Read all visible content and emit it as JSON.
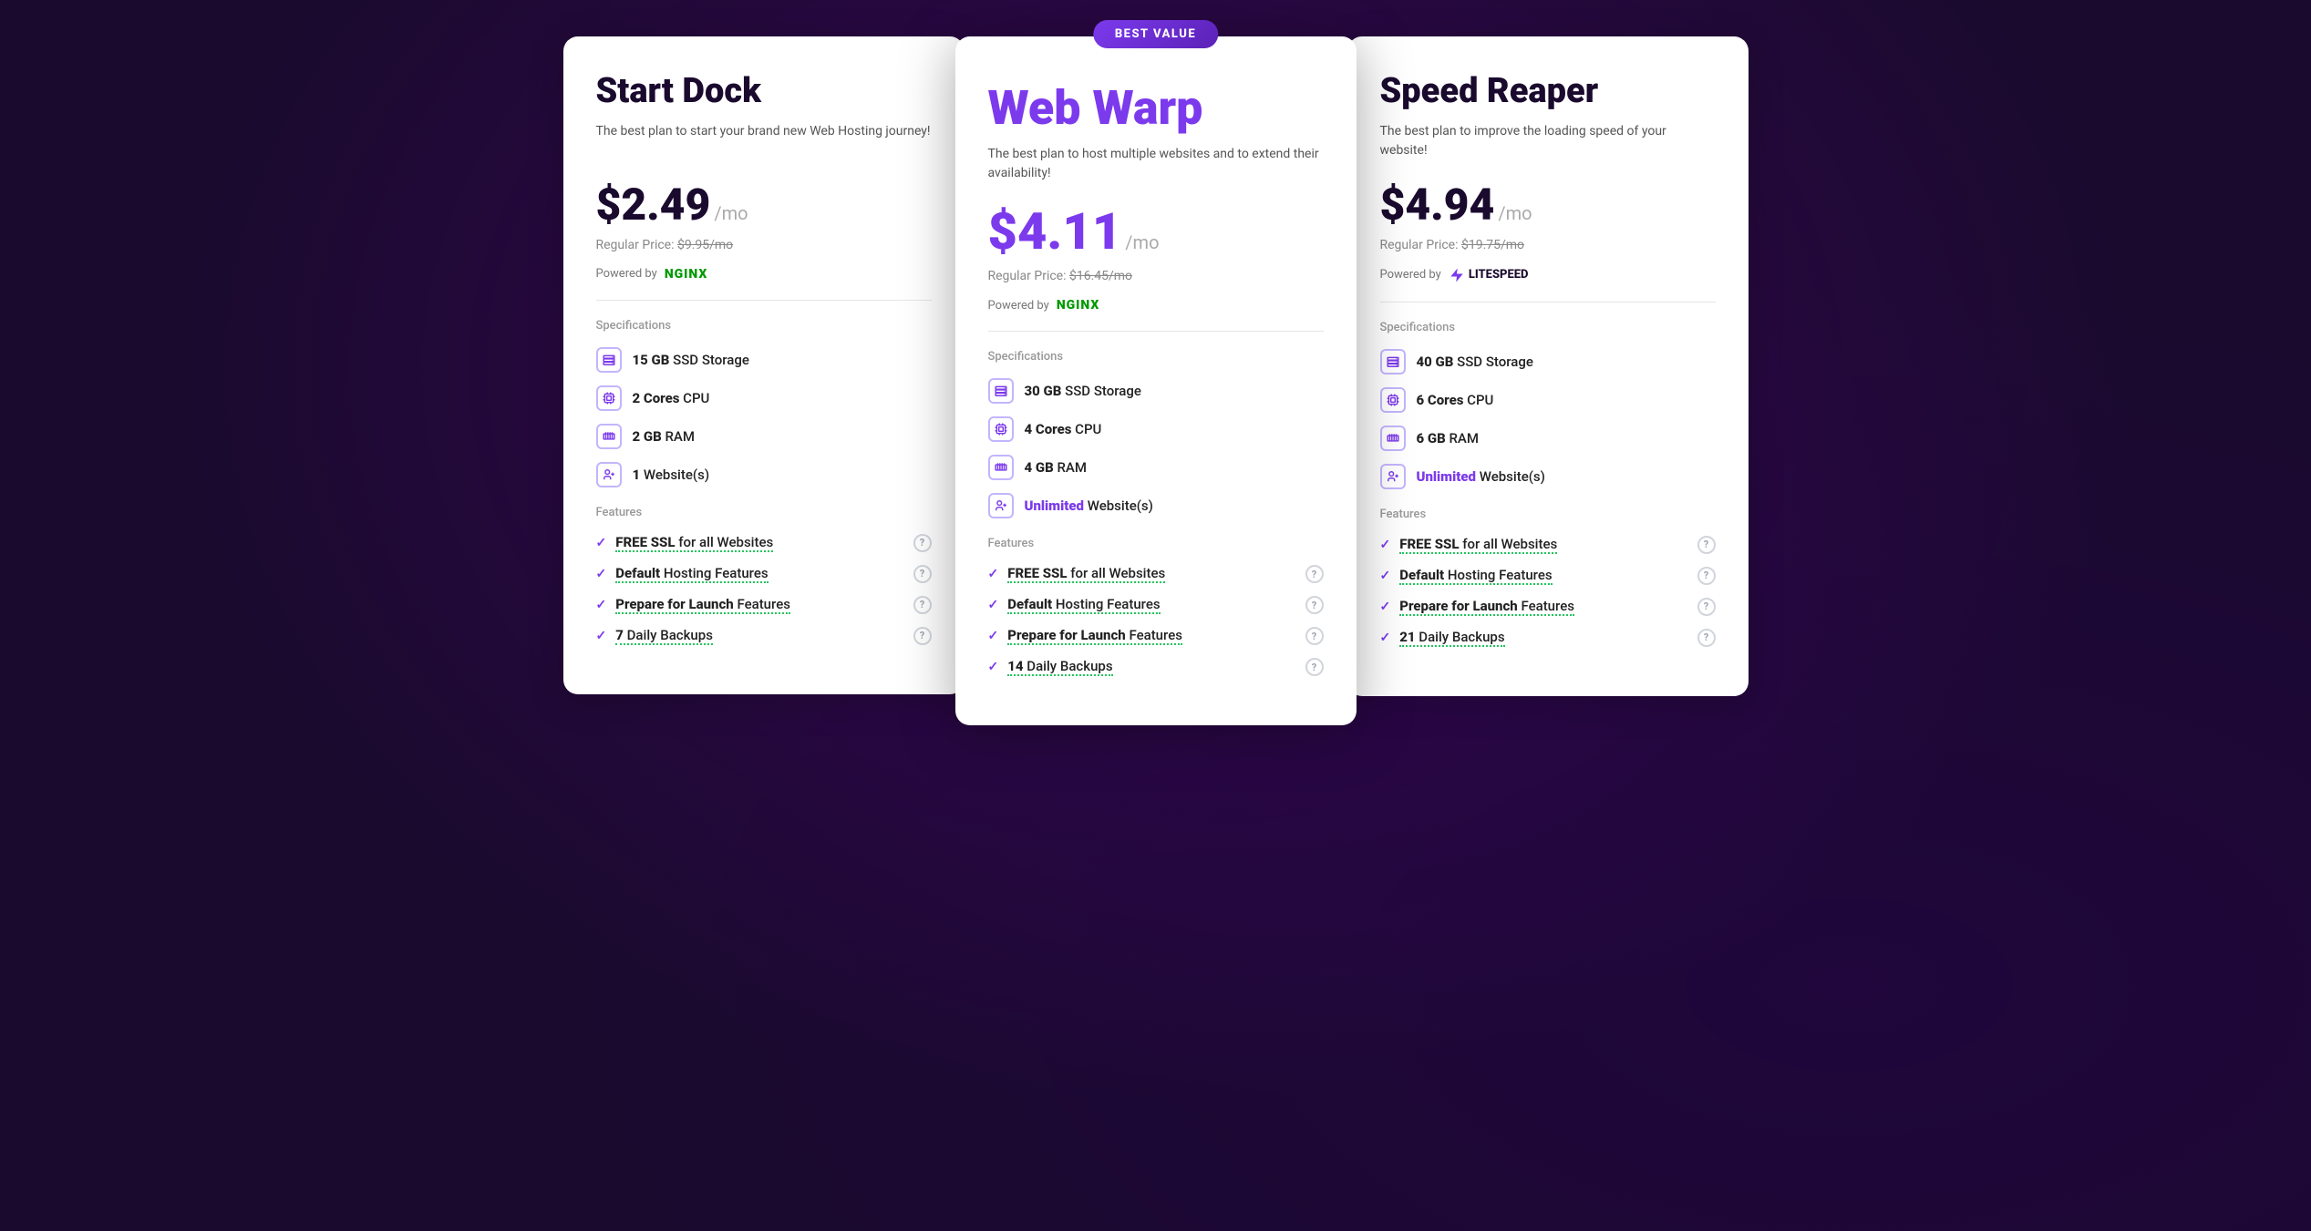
{
  "badge": {
    "label": "BEST VALUE"
  },
  "plans": [
    {
      "id": "start-dock",
      "title": "Start Dock",
      "title_style": "normal",
      "desc": "The best plan to start your brand new Web Hosting journey!",
      "price": "$2.49",
      "period": "/mo",
      "regular_price_label": "Regular Price:",
      "regular_price": "$9.95/mo",
      "powered_by": "Powered by",
      "engine": "nginx",
      "engine_label": "NGINX",
      "specs_label": "Specifications",
      "specs": [
        {
          "icon": "storage",
          "text_prefix": "",
          "value": "15 GB",
          "text_suffix": " SSD Storage"
        },
        {
          "icon": "cpu",
          "text_prefix": "",
          "value": "2 Cores",
          "text_suffix": " CPU"
        },
        {
          "icon": "ram",
          "text_prefix": "",
          "value": "2 GB",
          "text_suffix": " RAM"
        },
        {
          "icon": "sites",
          "text_prefix": "",
          "value": "1",
          "text_suffix": " Website(s)"
        }
      ],
      "features_label": "Features",
      "features": [
        {
          "text": "FREE SSL for all Websites",
          "bold_part": "FREE SSL"
        },
        {
          "text": "Default Hosting Features",
          "bold_part": "Default"
        },
        {
          "text": "Prepare for Launch Features",
          "bold_part": "Prepare for Launch"
        },
        {
          "text": "7 Daily Backups",
          "bold_part": "7"
        }
      ]
    },
    {
      "id": "web-warp",
      "title": "Web Warp",
      "title_style": "featured",
      "desc": "The best plan to host multiple websites and to extend their availability!",
      "price": "$4.11",
      "period": "/mo",
      "regular_price_label": "Regular Price:",
      "regular_price": "$16.45/mo",
      "powered_by": "Powered by",
      "engine": "nginx",
      "engine_label": "NGINX",
      "specs_label": "Specifications",
      "specs": [
        {
          "icon": "storage",
          "text_prefix": "",
          "value": "30 GB",
          "text_suffix": " SSD Storage"
        },
        {
          "icon": "cpu",
          "text_prefix": "",
          "value": "4 Cores",
          "text_suffix": " CPU"
        },
        {
          "icon": "ram",
          "text_prefix": "",
          "value": "4 GB",
          "text_suffix": " RAM"
        },
        {
          "icon": "sites",
          "text_prefix": "",
          "value": "Unlimited",
          "text_suffix": " Website(s)",
          "unlimited": true
        }
      ],
      "features_label": "Features",
      "features": [
        {
          "text": "FREE SSL for all Websites",
          "bold_part": "FREE SSL"
        },
        {
          "text": "Default Hosting Features",
          "bold_part": "Default"
        },
        {
          "text": "Prepare for Launch Features",
          "bold_part": "Prepare for Launch"
        },
        {
          "text": "14 Daily Backups",
          "bold_part": "14"
        }
      ]
    },
    {
      "id": "speed-reaper",
      "title": "Speed Reaper",
      "title_style": "normal",
      "desc": "The best plan to improve the loading speed of your website!",
      "price": "$4.94",
      "period": "/mo",
      "regular_price_label": "Regular Price:",
      "regular_price": "$19.75/mo",
      "powered_by": "Powered by",
      "engine": "litespeed",
      "engine_label": "LITESPEED",
      "specs_label": "Specifications",
      "specs": [
        {
          "icon": "storage",
          "text_prefix": "",
          "value": "40 GB",
          "text_suffix": " SSD Storage"
        },
        {
          "icon": "cpu",
          "text_prefix": "",
          "value": "6 Cores",
          "text_suffix": " CPU"
        },
        {
          "icon": "ram",
          "text_prefix": "",
          "value": "6 GB",
          "text_suffix": " RAM"
        },
        {
          "icon": "sites",
          "text_prefix": "",
          "value": "Unlimited",
          "text_suffix": " Website(s)",
          "unlimited": true
        }
      ],
      "features_label": "Features",
      "features": [
        {
          "text": "FREE SSL for all Websites",
          "bold_part": "FREE SSL"
        },
        {
          "text": "Default Hosting Features",
          "bold_part": "Default"
        },
        {
          "text": "Prepare for Launch Features",
          "bold_part": "Prepare for Launch"
        },
        {
          "text": "21 Daily Backups",
          "bold_part": "21"
        }
      ]
    }
  ]
}
